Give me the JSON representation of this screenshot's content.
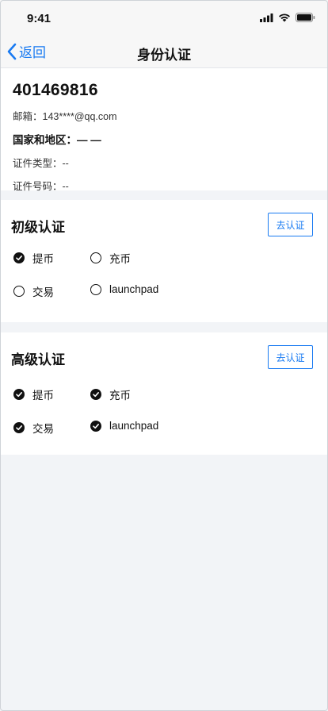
{
  "status": {
    "time": "9:41"
  },
  "nav": {
    "back_label": "返回",
    "title": "身份认证"
  },
  "profile": {
    "uid": "401469816",
    "email": "邮箱：143****@qq.com",
    "region": "国家和地区：— —",
    "id_type": "证件类型：--",
    "id_number": "证件号码：--"
  },
  "basic": {
    "title": "初级认证",
    "button": "去认证",
    "perms": [
      {
        "label": "提币",
        "checked": true
      },
      {
        "label": "充币",
        "checked": false
      },
      {
        "label": "交易",
        "checked": false
      },
      {
        "label": "launchpad",
        "checked": false
      }
    ]
  },
  "advanced": {
    "title": "高级认证",
    "button": "去认证",
    "perms": [
      {
        "label": "提币",
        "checked": true
      },
      {
        "label": "充币",
        "checked": true
      },
      {
        "label": "交易",
        "checked": true
      },
      {
        "label": "launchpad",
        "checked": true
      }
    ]
  },
  "colors": {
    "accent": "#1a7bf2",
    "page_bg": "#f2f4f7"
  }
}
